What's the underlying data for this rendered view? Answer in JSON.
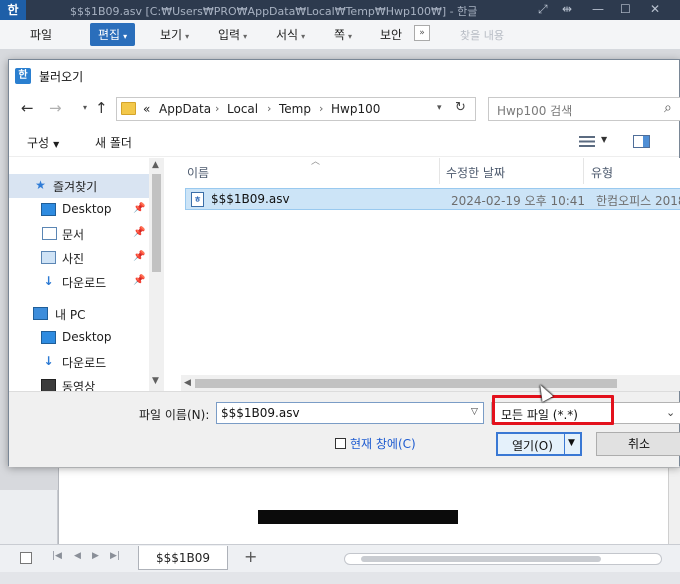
{
  "app": {
    "logo": "한",
    "title": "$$$1B09.asv [C:₩Users₩PRO₩AppData₩Local₩Temp₩Hwp100₩] - 한글",
    "menu": [
      {
        "label": "파일"
      },
      {
        "label": "편집"
      },
      {
        "label": "보기"
      },
      {
        "label": "입력"
      },
      {
        "label": "서식"
      },
      {
        "label": "쪽"
      },
      {
        "label": "보안"
      }
    ],
    "more": "»",
    "ghost_menu": "찾을 내용",
    "sheet_tab": "$$$1B09",
    "add_tab": "+"
  },
  "dialog": {
    "icon": "한",
    "title": "불러오기",
    "nav": {
      "back": "←",
      "forward": "→",
      "up": "↑",
      "refresh": "↻"
    },
    "breadcrumb": {
      "prefix": "«",
      "items": [
        "AppData",
        "Local",
        "Temp",
        "Hwp100"
      ]
    },
    "search_placeholder": "Hwp100 검색",
    "toolbar": {
      "organize": "구성",
      "new_folder": "새 폴더"
    },
    "sidebar": {
      "items": [
        {
          "label": "즐겨찾기",
          "icon": "star-icon"
        },
        {
          "label": "Desktop",
          "icon": "desktop-icon",
          "pinned": true
        },
        {
          "label": "문서",
          "icon": "document-icon",
          "pinned": true
        },
        {
          "label": "사진",
          "icon": "pictures-icon",
          "pinned": true
        },
        {
          "label": "다운로드",
          "icon": "download-icon",
          "pinned": true
        },
        {
          "label": "내 PC",
          "icon": "pc-icon"
        },
        {
          "label": "Desktop",
          "icon": "desktop-icon"
        },
        {
          "label": "다운로드",
          "icon": "download-icon"
        },
        {
          "label": "동영상",
          "icon": "video-icon"
        }
      ]
    },
    "columns": {
      "name": "이름",
      "modified": "수정한 날짜",
      "type": "유형"
    },
    "files": [
      {
        "name": "$$$1B09.asv",
        "modified": "2024-02-19 오후 10:41",
        "type": "한컴오피스 2018"
      }
    ],
    "filename_label": "파일 이름(N):",
    "filename_value": "$$$1B09.asv",
    "filetype_value": "모든 파일 (*.*)",
    "checkbox_label": "현재 창에(C)",
    "open_button": "열기(O)",
    "cancel_button": "취소"
  },
  "colors": {
    "accent": "#2a6ebb",
    "highlight": "#e3111c",
    "selection": "#cce4f7"
  }
}
